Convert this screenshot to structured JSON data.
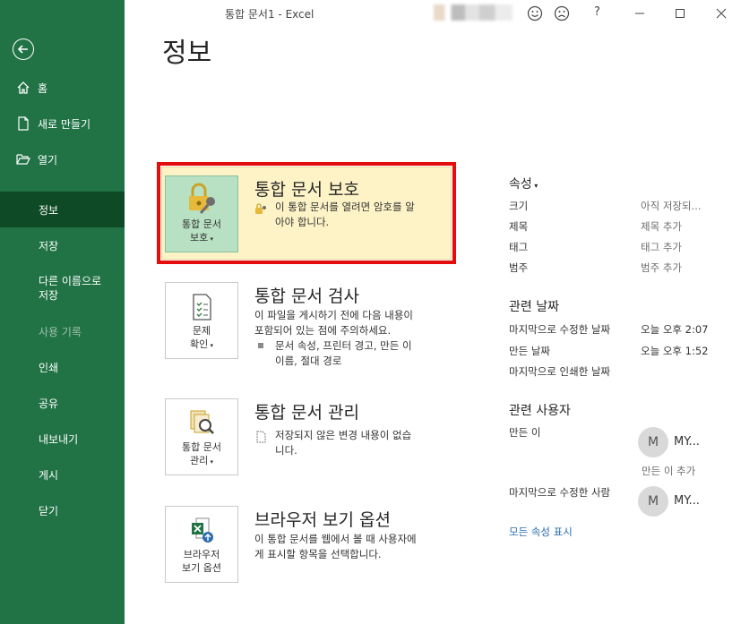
{
  "titlebar": {
    "title": "통합 문서1  -  Excel",
    "help": "?"
  },
  "page_title": "정보",
  "sidebar": {
    "items": [
      {
        "label": "홈"
      },
      {
        "label": "새로 만들기"
      },
      {
        "label": "열기"
      },
      {
        "label": "정보"
      },
      {
        "label": "저장"
      },
      {
        "label": "다른 이름으로"
      },
      {
        "label": "사용 기록"
      },
      {
        "label": "인쇄"
      },
      {
        "label": "공유"
      },
      {
        "label": "내보내기"
      },
      {
        "label": "게시"
      },
      {
        "label": "닫기"
      }
    ],
    "save_as_line2": "저장"
  },
  "sections": {
    "protect": {
      "heading": "통합 문서 보호",
      "button_line1": "통합 문서",
      "button_line2": "보호",
      "desc_line1": "이 통합 문서를 열려면 암호를 알",
      "desc_line2": "아야 합니다."
    },
    "inspect": {
      "heading": "통합 문서 검사",
      "button_line1": "문제",
      "button_line2": "확인",
      "desc_line1": "이 파일을 게시하기 전에 다음 내용이",
      "desc_line2": "포함되어 있는 점에 주의하세요.",
      "bullet_line1": "문서 속성, 프린터 경고, 만든 이",
      "bullet_line2": "이름, 절대 경로"
    },
    "manage": {
      "heading": "통합 문서 관리",
      "button_line1": "통합 문서",
      "button_line2": "관리",
      "desc_line1": "저장되지 않은 변경 내용이 없습",
      "desc_line2": "니다."
    },
    "browser": {
      "heading": "브라우저 보기 옵션",
      "button_line1": "브라우저",
      "button_line2": "보기 옵션",
      "desc_line1": "이 통합 문서를 웹에서 볼 때 사용자에",
      "desc_line2": "게 표시할 항목을 선택합니다."
    }
  },
  "properties": {
    "heading": "속성",
    "rows": [
      {
        "label": "크기",
        "value": "아직 저장되..."
      },
      {
        "label": "제목",
        "value": "제목 추가"
      },
      {
        "label": "태그",
        "value": "태그 추가"
      },
      {
        "label": "범주",
        "value": "범주 추가"
      }
    ]
  },
  "related_dates": {
    "heading": "관련 날짜",
    "rows": [
      {
        "label": "마지막으로 수정한 날짜",
        "value": "오늘 오후 2:07"
      },
      {
        "label": "만든 날짜",
        "value": "오늘 오후 1:52"
      },
      {
        "label": "마지막으로 인쇄한 날짜",
        "value": ""
      }
    ]
  },
  "related_people": {
    "heading": "관련 사용자",
    "author_label": "만든 이",
    "author_initial": "M",
    "author_name": "MY...",
    "add_author": "만든 이 추가",
    "modified_by_label": "마지막으로 수정한 사람",
    "modified_initial": "M",
    "modified_name": "MY..."
  },
  "show_all_link": "모든 속성 표시",
  "colors": {
    "sidebar": "#217346",
    "sidebar_active": "#0e4a25",
    "highlight": "#e40c0c",
    "protect_bg": "#fdf3c6"
  }
}
